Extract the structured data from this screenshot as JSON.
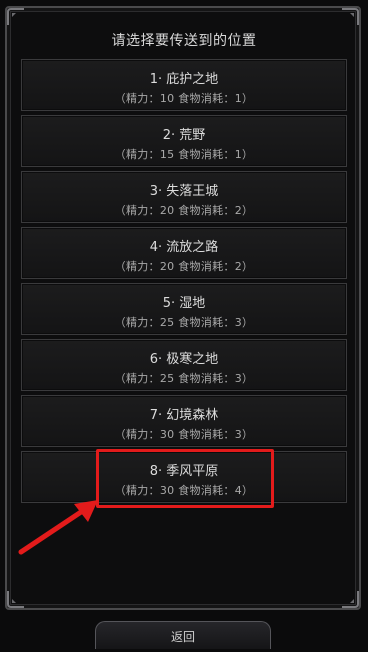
{
  "header": {
    "title": "请选择要传送到的位置"
  },
  "locations": [
    {
      "name": "1· 庇护之地",
      "stats": "（精力：10    食物消耗：1）"
    },
    {
      "name": "2· 荒野",
      "stats": "（精力：15    食物消耗：1）"
    },
    {
      "name": "3· 失落王城",
      "stats": "（精力：20    食物消耗：2）"
    },
    {
      "name": "4· 流放之路",
      "stats": "（精力：20    食物消耗：2）"
    },
    {
      "name": "5· 湿地",
      "stats": "（精力：25    食物消耗：3）"
    },
    {
      "name": "6· 极寒之地",
      "stats": "（精力：25    食物消耗：3）"
    },
    {
      "name": "7· 幻境森林",
      "stats": "（精力：30    食物消耗：3）"
    },
    {
      "name": "8· 季风平原",
      "stats": "（精力：30    食物消耗：4）"
    }
  ],
  "footer": {
    "back_label": "返回"
  },
  "annotation": {
    "highlight_color": "#e31b1b",
    "highlighted_item": "8· 季风平原"
  }
}
